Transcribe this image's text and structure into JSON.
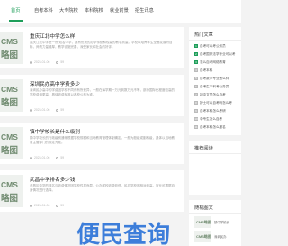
{
  "nav": {
    "items": [
      "首页",
      "自考本科",
      "大专院校",
      "本科院校",
      "就业前景",
      "招生讯息"
    ]
  },
  "thumb": {
    "line1": "CMS",
    "line2": "略图"
  },
  "articles": [
    {
      "title": "重庆江北中学怎么样",
      "desc": "重庆江北中学是一所 知名中学，具有优良的办学传统和较高的教学质量。学校以培养学生全面发展为目标，师资力量雄厚，教学设施完善，深受家长和社会的好评。",
      "date": "2023-01-06",
      "views": "59"
    },
    {
      "title": "深圳民办高中学费多少",
      "desc": "深圳民办高中的学费因学校不同而有所差异，一般在每学期一万元到数万元不等，部分国际化程度较高的学校费用更高，具体收费标准以各校公布为准。",
      "date": "2023-01-06",
      "views": "59"
    },
    {
      "title": "镇中学校长是什么级别",
      "desc": "镇中学校长的行政级别通常根据学校规模和当地教育管理体制确定，一般为股级或副科级，具体以当地教育主管部门的规定为准。",
      "date": "2023-01-06",
      "views": "59"
    },
    {
      "title": "武昌中学排名多少钱",
      "desc": "武昌区中学的排名与收费情况因学校性质而异，公办学校收费较低，民办学校则相对较高，家长可根据自身情况进行选择。",
      "date": "2023-01-06",
      "views": "59"
    }
  ],
  "sidebar": {
    "hot_title": "热门文章",
    "hot_items": [
      "自考可以考公务员",
      "自考国家法学专业可以考",
      "怎么自考网络教育",
      "自考本科",
      "自考数学专业怎么样",
      "自考生本科考公务员",
      "初中文凭怎么自考",
      "护士可以自考吗怎么考",
      "自考本科怎么考研",
      "中专生怎么自考",
      "自考本科怎么报名"
    ],
    "rec_title": "推荐阅读",
    "rand_title": "随机图文",
    "rand_items": [
      {
        "thumb": "CMS略图",
        "text": "镇中学校长"
      },
      {
        "thumb": "CMS略图",
        "text": "深圳民办"
      },
      {
        "thumb": "CMS略图",
        "text": "武昌中学"
      }
    ]
  },
  "watermark": "便民查询",
  "colors": {
    "accent": "#1e9e5a",
    "watermark": "#1e6ad6"
  }
}
